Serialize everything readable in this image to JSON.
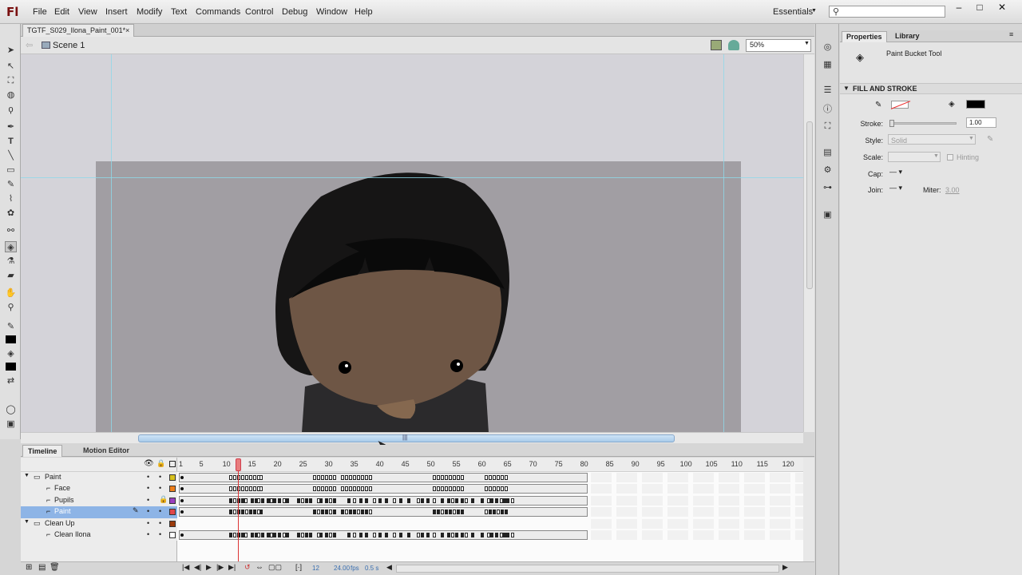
{
  "app": {
    "logo": "Fl",
    "menus": [
      "File",
      "Edit",
      "View",
      "Insert",
      "Modify",
      "Text",
      "Commands",
      "Control",
      "Debug",
      "Window",
      "Help"
    ],
    "workspace": "Essentials",
    "search_placeholder": "",
    "window_buttons": [
      "–",
      "□",
      "✕"
    ]
  },
  "document": {
    "tab_title": "TGTF_S029_Ilona_Paint_001*",
    "close": "×",
    "scene": "Scene 1",
    "zoom": "50%"
  },
  "timeline": {
    "tabs": [
      "Timeline",
      "Motion Editor"
    ],
    "ruler": [
      "1",
      "5",
      "10",
      "15",
      "20",
      "25",
      "30",
      "35",
      "40",
      "45",
      "50",
      "55",
      "60",
      "65",
      "70",
      "75",
      "80",
      "85",
      "90",
      "95",
      "100",
      "105",
      "110",
      "115",
      "120"
    ],
    "layers": [
      {
        "name": "Paint",
        "type": "folder",
        "color": "#d8c21e",
        "selected": false
      },
      {
        "name": "Face",
        "type": "layer",
        "color": "#ef7f1a",
        "selected": false
      },
      {
        "name": "Pupils",
        "type": "layer",
        "color": "#9a3fbf",
        "selected": false
      },
      {
        "name": "Paint",
        "type": "layer",
        "color": "#e0464a",
        "selected": true
      },
      {
        "name": "Clean Up",
        "type": "folder",
        "color": "#9b3b0b",
        "selected": false
      },
      {
        "name": "Clean Ilona",
        "type": "layer",
        "color": "#ffffff",
        "selected": false
      }
    ],
    "current_frame": "12",
    "fps": "24.00",
    "fps_unit": "fps",
    "time": "0.5 s"
  },
  "properties": {
    "tabs": [
      "Properties",
      "Library"
    ],
    "tool_name": "Paint Bucket Tool",
    "section": "FILL AND STROKE",
    "stroke_label": "Stroke:",
    "stroke_value": "1.00",
    "style_label": "Style:",
    "style_value": "Solid",
    "scale_label": "Scale:",
    "hinting_label": "Hinting",
    "cap_label": "Cap:",
    "join_label": "Join:",
    "miter_label": "Miter:",
    "miter_value": "3.00",
    "fill_color": "#000000",
    "stroke_color": "none"
  },
  "colors": {
    "stage": "#a19ea3",
    "hood": "#161515",
    "skin": "#6e5645",
    "selection": "#8db4e6",
    "playhead": "#e86a6a"
  }
}
